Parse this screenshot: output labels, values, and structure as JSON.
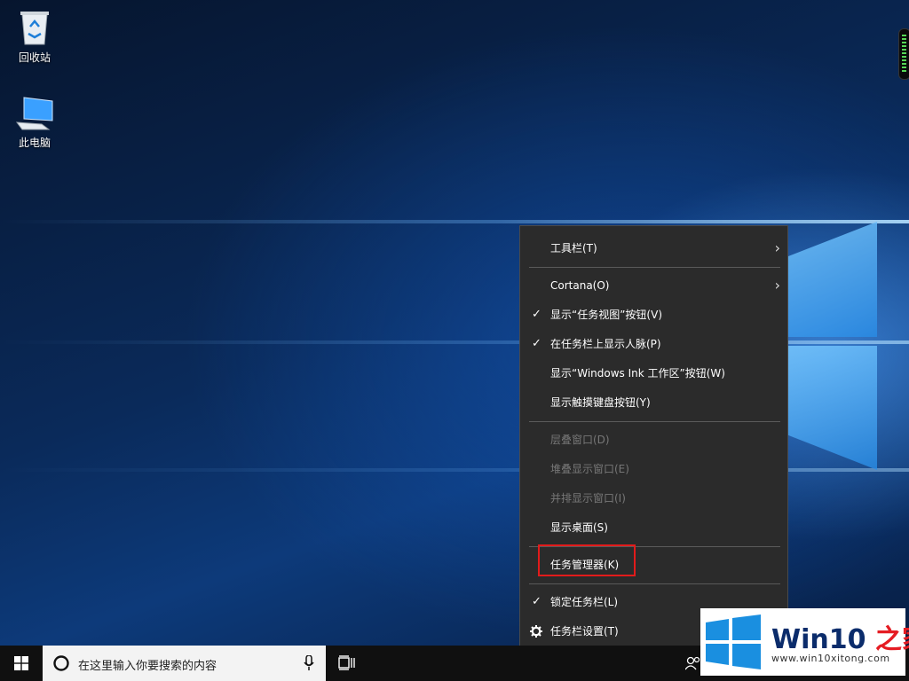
{
  "desktop": {
    "icons": [
      {
        "label": "回收站",
        "icon": "recycle-bin-icon"
      },
      {
        "label": "此电脑",
        "icon": "computer-icon"
      }
    ]
  },
  "context_menu": {
    "items": [
      {
        "label": "工具栏(T)",
        "checked": false,
        "submenu": true,
        "enabled": true
      },
      {
        "label": "Cortana(O)",
        "checked": false,
        "submenu": true,
        "enabled": true
      },
      {
        "label": "显示“任务视图”按钮(V)",
        "checked": true,
        "submenu": false,
        "enabled": true
      },
      {
        "label": "在任务栏上显示人脉(P)",
        "checked": true,
        "submenu": false,
        "enabled": true
      },
      {
        "label": "显示“Windows Ink 工作区”按钮(W)",
        "checked": false,
        "submenu": false,
        "enabled": true
      },
      {
        "label": "显示触摸键盘按钮(Y)",
        "checked": false,
        "submenu": false,
        "enabled": true
      },
      {
        "label": "层叠窗口(D)",
        "checked": false,
        "submenu": false,
        "enabled": false
      },
      {
        "label": "堆叠显示窗口(E)",
        "checked": false,
        "submenu": false,
        "enabled": false
      },
      {
        "label": "并排显示窗口(I)",
        "checked": false,
        "submenu": false,
        "enabled": false
      },
      {
        "label": "显示桌面(S)",
        "checked": false,
        "submenu": false,
        "enabled": true
      },
      {
        "label": "任务管理器(K)",
        "checked": false,
        "submenu": false,
        "enabled": true,
        "highlighted": true
      },
      {
        "label": "锁定任务栏(L)",
        "checked": true,
        "submenu": false,
        "enabled": true
      },
      {
        "label": "任务栏设置(T)",
        "checked": false,
        "submenu": false,
        "enabled": true,
        "icon": "gear-icon"
      }
    ],
    "check_glyph": "✓",
    "arrow_glyph": "›",
    "highlight_color": "#e21b1b"
  },
  "taskbar": {
    "search_placeholder": "在这里输入你要搜索的内容",
    "icons": [
      "windows-start-icon",
      "cortana-circle-icon",
      "microphone-icon",
      "task-view-icon",
      "people-icon"
    ]
  },
  "watermark": {
    "title_prefix": "Win10 ",
    "title_highlight": "之家",
    "url": "www.win10xitong.com",
    "logo_color": "#1a8fe0"
  }
}
